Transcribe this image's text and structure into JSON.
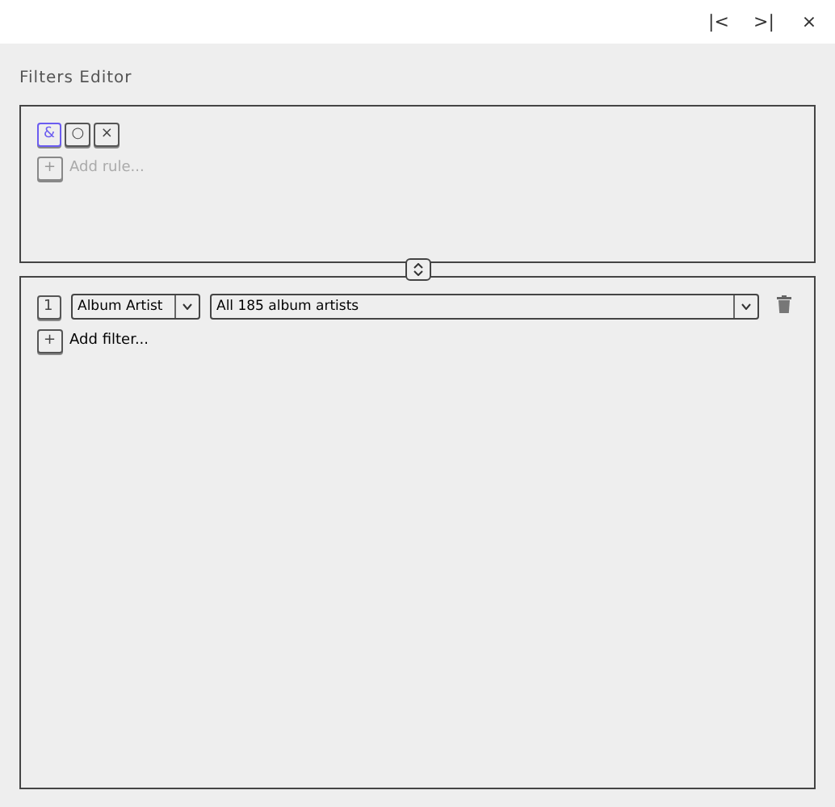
{
  "header": {
    "buttons": [
      "|<",
      ">|",
      "×"
    ]
  },
  "title": "Filters Editor",
  "rules": {
    "operators": [
      {
        "label": "&",
        "selected": true
      },
      {
        "label": "○",
        "selected": false
      },
      {
        "label": "×",
        "selected": false
      }
    ],
    "add": {
      "icon": "+",
      "label": "Add rule...",
      "disabled": true
    }
  },
  "filters": {
    "items": [
      {
        "index": "1",
        "field": "Album Artist",
        "value": "All 185 album artists"
      }
    ],
    "add": {
      "icon": "+",
      "label": "Add filter...",
      "disabled": false
    }
  }
}
